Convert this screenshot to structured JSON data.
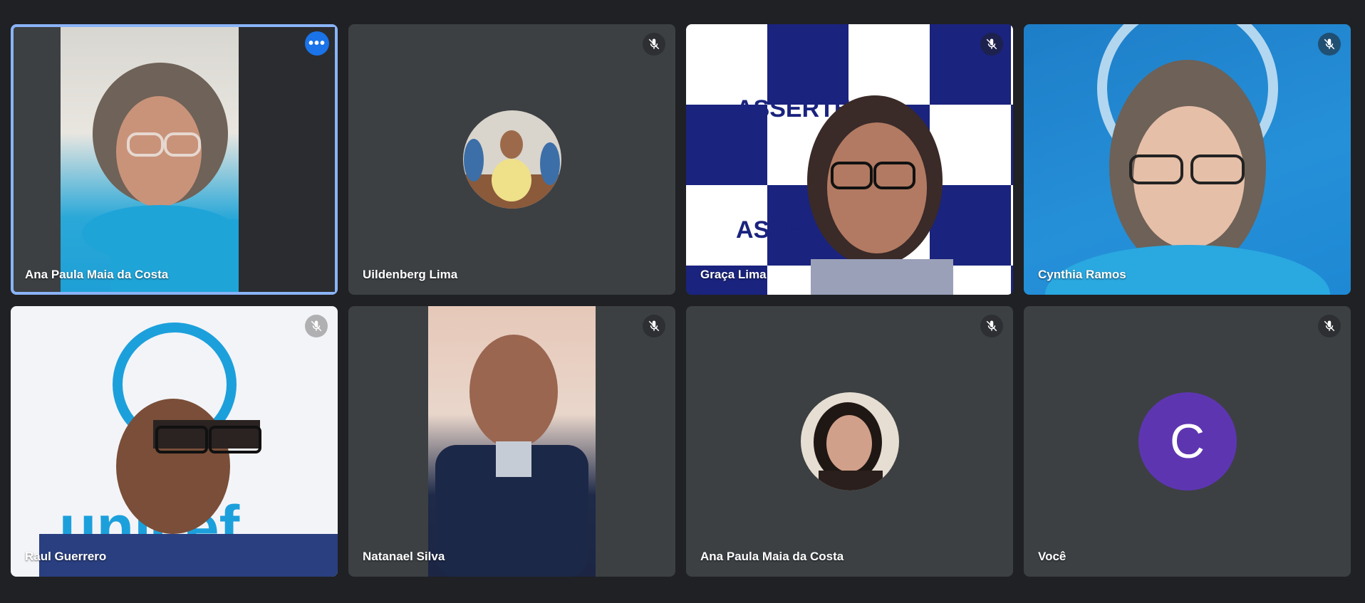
{
  "participants": [
    {
      "name": "Ana Paula Maia da Costa",
      "state": "video",
      "more_label": "•••"
    },
    {
      "name": "Uildenberg Lima",
      "state": "avatar-photo",
      "mic": "muted"
    },
    {
      "name": "Graça Lima",
      "state": "video",
      "mic": "muted",
      "backdrop_text": "ASSERTE"
    },
    {
      "name": "Cynthia Ramos",
      "state": "video",
      "mic": "muted"
    },
    {
      "name": "Raul Guerrero",
      "state": "video",
      "mic": "muted",
      "backdrop_text": "unicef"
    },
    {
      "name": "Natanael Silva",
      "state": "video",
      "mic": "muted"
    },
    {
      "name": "Ana Paula Maia da Costa",
      "state": "avatar-photo",
      "mic": "muted"
    },
    {
      "name": "Você",
      "state": "letter-avatar",
      "mic": "muted",
      "initial": "C",
      "avatar_color": "#5e35b1"
    }
  ],
  "icons": {
    "muted": "mic-off-icon",
    "more": "more-options-icon"
  },
  "colors": {
    "background": "#202124",
    "tile": "#3c4043",
    "active_border": "#8ab4f8",
    "more_button": "#1a73e8"
  }
}
